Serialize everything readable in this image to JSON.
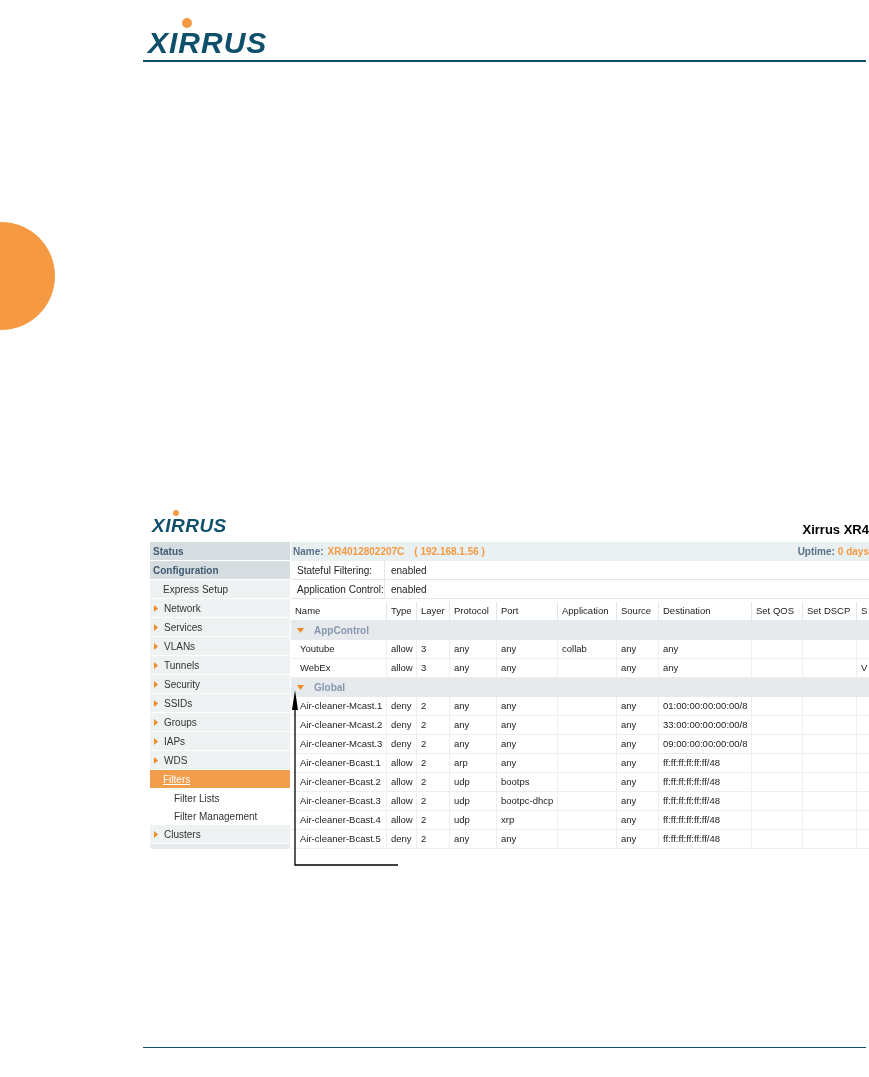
{
  "page_header": {
    "logo": "XIRRUS"
  },
  "screenshot": {
    "logo": "XIRRUS",
    "title": "Xirrus XR4",
    "name_bar": {
      "label": "Name:",
      "device": "XR4012802207C",
      "ip": "( 192.168.1.56 )",
      "uptime_label": "Uptime:",
      "uptime": "0 days"
    },
    "sidebar": [
      {
        "label": "Status",
        "kind": "section"
      },
      {
        "label": "Configuration",
        "kind": "section"
      },
      {
        "label": "Express Setup",
        "kind": "link",
        "selected": false
      },
      {
        "label": "Network",
        "kind": "group",
        "selected": false
      },
      {
        "label": "Services",
        "kind": "group",
        "selected": false
      },
      {
        "label": "VLANs",
        "kind": "group",
        "selected": false
      },
      {
        "label": "Tunnels",
        "kind": "group",
        "selected": false
      },
      {
        "label": "Security",
        "kind": "group",
        "selected": false
      },
      {
        "label": "SSIDs",
        "kind": "group",
        "selected": false
      },
      {
        "label": "Groups",
        "kind": "group",
        "selected": false
      },
      {
        "label": "IAPs",
        "kind": "group",
        "selected": false
      },
      {
        "label": "WDS",
        "kind": "group",
        "selected": false
      },
      {
        "label": "Filters",
        "kind": "link",
        "selected": true,
        "children": [
          {
            "label": "Filter Lists",
            "kind": "sub",
            "selected": false
          },
          {
            "label": "Filter Management",
            "kind": "sub",
            "selected": false
          }
        ]
      },
      {
        "label": "Clusters",
        "kind": "group",
        "selected": false
      }
    ],
    "settings": [
      {
        "label": "Stateful Filtering:",
        "value": "enabled"
      },
      {
        "label": "Application Control:",
        "value": "enabled"
      }
    ],
    "table": {
      "columns": [
        "Name",
        "Type",
        "Layer",
        "Protocol",
        "Port",
        "Application",
        "Source",
        "Destination",
        "Set QOS",
        "Set DSCP",
        "S"
      ],
      "groups": [
        {
          "name": "AppControl",
          "expanded": true,
          "rows": [
            [
              "Youtube",
              "allow",
              "3",
              "any",
              "any",
              "collab",
              "any",
              "any",
              null,
              null,
              null
            ],
            [
              "WebEx",
              "allow",
              "3",
              "any",
              "any",
              null,
              "any",
              "any",
              null,
              null,
              "V"
            ]
          ]
        },
        {
          "name": "Global",
          "expanded": true,
          "rows": [
            [
              "Air-cleaner-Mcast.1",
              "deny",
              "2",
              "any",
              "any",
              null,
              "any",
              "01:00:00:00:00:00/8",
              null,
              null,
              null
            ],
            [
              "Air-cleaner-Mcast.2",
              "deny",
              "2",
              "any",
              "any",
              null,
              "any",
              "33:00:00:00:00:00/8",
              null,
              null,
              null
            ],
            [
              "Air-cleaner-Mcast.3",
              "deny",
              "2",
              "any",
              "any",
              null,
              "any",
              "09:00:00:00:00:00/8",
              null,
              null,
              null
            ],
            [
              "Air-cleaner-Bcast.1",
              "allow",
              "2",
              "arp",
              "any",
              null,
              "any",
              "ff:ff:ff:ff:ff:ff/48",
              null,
              null,
              null
            ],
            [
              "Air-cleaner-Bcast.2",
              "allow",
              "2",
              "udp",
              "bootps",
              null,
              "any",
              "ff:ff:ff:ff:ff:ff/48",
              null,
              null,
              null
            ],
            [
              "Air-cleaner-Bcast.3",
              "allow",
              "2",
              "udp",
              "bootpc-dhcp",
              null,
              "any",
              "ff:ff:ff:ff:ff:ff/48",
              null,
              null,
              null
            ],
            [
              "Air-cleaner-Bcast.4",
              "allow",
              "2",
              "udp",
              "xrp",
              null,
              "any",
              "ff:ff:ff:ff:ff:ff/48",
              null,
              null,
              null
            ],
            [
              "Air-cleaner-Bcast.5",
              "deny",
              "2",
              "any",
              "any",
              null,
              "any",
              "ff:ff:ff:ff:ff:ff/48",
              null,
              null,
              null
            ]
          ]
        }
      ]
    }
  }
}
